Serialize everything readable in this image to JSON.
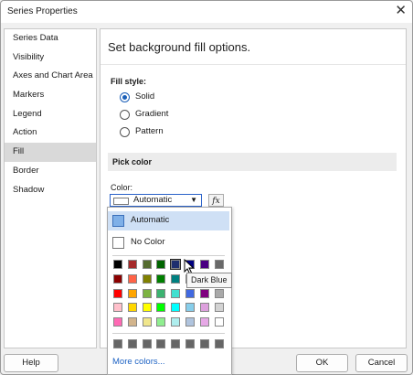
{
  "window": {
    "title": "Series Properties"
  },
  "sidebar": {
    "items": [
      {
        "label": "Series Data"
      },
      {
        "label": "Visibility"
      },
      {
        "label": "Axes and Chart Area"
      },
      {
        "label": "Markers"
      },
      {
        "label": "Legend"
      },
      {
        "label": "Action"
      },
      {
        "label": "Fill",
        "active": true
      },
      {
        "label": "Border"
      },
      {
        "label": "Shadow"
      }
    ]
  },
  "content": {
    "heading": "Set background fill options.",
    "fill_style_label": "Fill style:",
    "fill_options": [
      {
        "label": "Solid",
        "selected": true
      },
      {
        "label": "Gradient",
        "selected": false
      },
      {
        "label": "Pattern",
        "selected": false
      }
    ],
    "pick_color_label": "Pick color",
    "color_label": "Color:",
    "color_value": "Automatic",
    "fx_label": "fx"
  },
  "popup": {
    "automatic_label": "Automatic",
    "no_color_label": "No Color",
    "more_colors_label": "More colors...",
    "tooltip": "Dark Blue",
    "palette": [
      [
        "#000000",
        "#a52a2a",
        "#556b2f",
        "#006400",
        "#1f2f6f",
        "#000080",
        "#4b0082",
        "#696969"
      ],
      [
        "#8b0000",
        "#ff6347",
        "#808000",
        "#008000",
        "#008080",
        "#0000ff",
        "#708090",
        "#808080"
      ],
      [
        "#ff0000",
        "#ffa500",
        "#7cb342",
        "#3cb371",
        "#40e0d0",
        "#4169e1",
        "#800080",
        "#a9a9a9"
      ],
      [
        "#ffc0cb",
        "#ffd700",
        "#ffff00",
        "#00ff00",
        "#00ffff",
        "#87ceeb",
        "#dda0dd",
        "#d3d3d3"
      ],
      [
        "#ff69b4",
        "#d2b48c",
        "#f0e68c",
        "#90ee90",
        "#afeeee",
        "#b0c4de",
        "#e6a8e6",
        "#ffffff"
      ]
    ],
    "recent": [
      "#666666",
      "#666666",
      "#666666",
      "#666666",
      "#666666",
      "#666666",
      "#666666",
      "#666666"
    ]
  },
  "buttons": {
    "help": "Help",
    "ok": "OK",
    "cancel": "Cancel"
  }
}
